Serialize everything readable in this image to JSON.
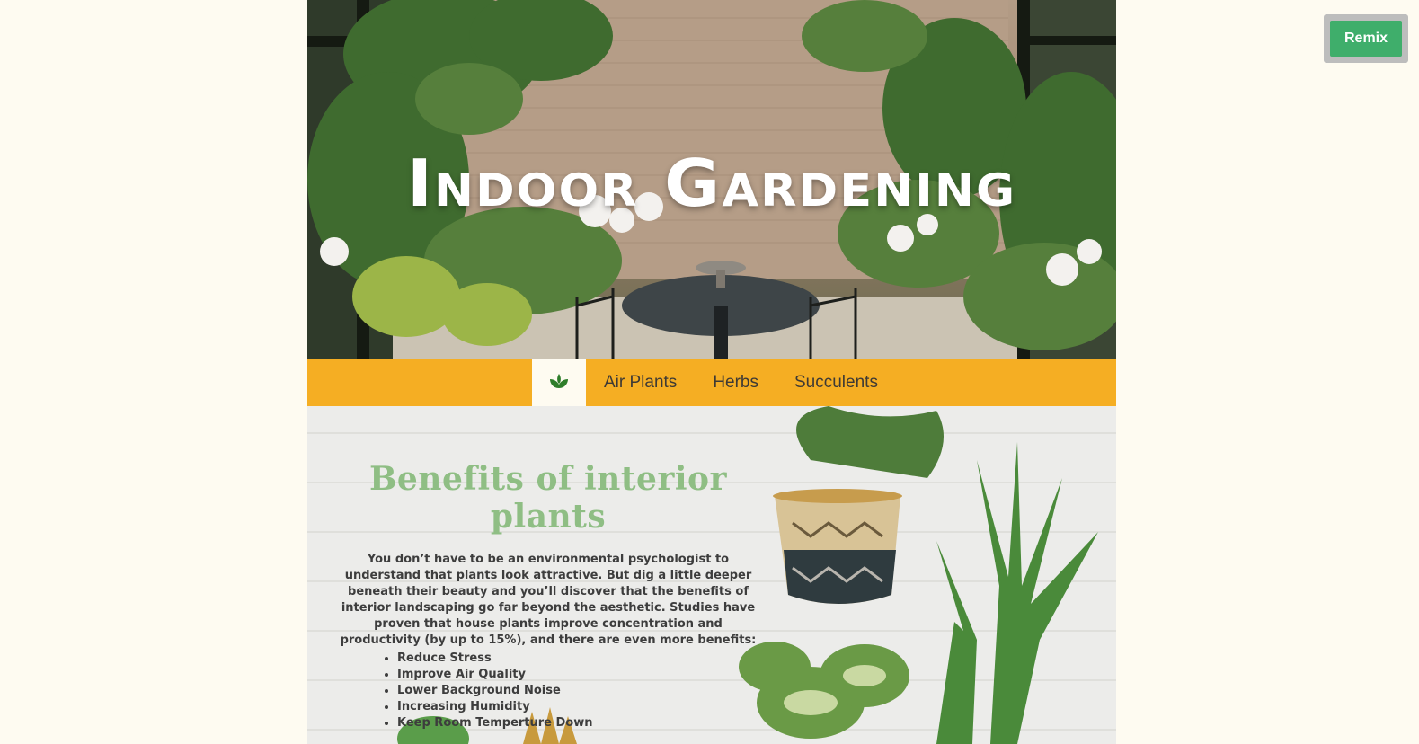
{
  "hero": {
    "title": "Indoor Gardening"
  },
  "nav": {
    "home_icon": "plant-sprout-icon",
    "items": [
      {
        "label": "Air Plants"
      },
      {
        "label": "Herbs"
      },
      {
        "label": "Succulents"
      }
    ]
  },
  "benefits": {
    "title": "Benefits of interior plants",
    "text": "You don’t have to be an environmental psychologist to understand that plants look attractive. But dig a little deeper beneath their beauty and you’ll discover that the benefits of interior landscaping go far beyond the aesthetic. Studies have proven that house plants improve concentration and productivity (by up to 15%), and there are even more benefits:",
    "items": [
      "Reduce Stress",
      "Improve Air Quality",
      "Lower Background Noise",
      "Increasing Humidity",
      "Keep Room Temperture Down"
    ]
  },
  "remix": {
    "label": "Remix"
  },
  "colors": {
    "page_background": "#fefbf1",
    "nav_background": "#f5ae23",
    "heading_green": "#8fbe84",
    "remix_green": "#3fae6b",
    "icon_green": "#2e7d2a"
  }
}
